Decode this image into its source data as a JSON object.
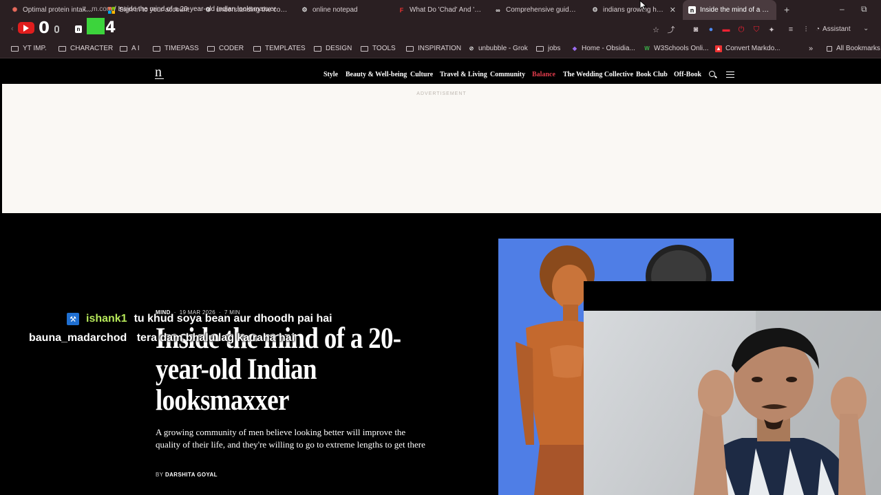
{
  "browser": {
    "tabs": [
      {
        "label": "Optimal protein intake pe",
        "icon": "sparkle-tab-icon",
        "active": false
      },
      {
        "label": "Sign in to your account",
        "icon": "microsoft-tab-icon",
        "active": false
      },
      {
        "label": "understanding the conce",
        "icon": "openai-tab-icon",
        "active": false
      },
      {
        "label": "online notepad",
        "icon": "openai-tab-icon",
        "active": false
      },
      {
        "label": "What Do 'Chad' And 'Chu",
        "icon": "f-tab-icon",
        "active": false
      },
      {
        "label": "Comprehensive guide to c",
        "icon": "infinity-tab-icon",
        "active": false
      },
      {
        "label": "indians growing hype",
        "icon": "openai-tab-icon",
        "active": false
      },
      {
        "label": "Inside the mind of a 20-ye",
        "icon": "n-tab-icon",
        "active": true
      }
    ],
    "address": {
      "domain": "t...m.com",
      "path": "/ Inside the mind of a 20-year-old Indian looksmaxxer"
    },
    "assistant_label": "Assistant",
    "bookmarks": [
      {
        "label": "YT IMP.",
        "type": "folder"
      },
      {
        "label": "CHARACTER",
        "type": "folder"
      },
      {
        "label": "A I",
        "type": "folder"
      },
      {
        "label": "TIMEPASS",
        "type": "folder"
      },
      {
        "label": "CODER",
        "type": "folder"
      },
      {
        "label": "TEMPLATES",
        "type": "folder"
      },
      {
        "label": "DESIGN",
        "type": "folder"
      },
      {
        "label": "TOOLS",
        "type": "folder"
      },
      {
        "label": "INSPIRATION",
        "type": "folder"
      },
      {
        "label": "unbubble - Grok",
        "type": "link"
      },
      {
        "label": "jobs",
        "type": "folder"
      },
      {
        "label": "Home - Obsidia...",
        "type": "link"
      },
      {
        "label": "W3Schools Onli...",
        "type": "link"
      },
      {
        "label": "Convert Markdo...",
        "type": "link"
      }
    ],
    "all_bookmarks_label": "All Bookmarks"
  },
  "stream_overlay": {
    "counter_left": "0",
    "counter_right": "4"
  },
  "site": {
    "logo": "n",
    "nav": [
      {
        "label": "Style",
        "highlight": false
      },
      {
        "label": "Beauty & Well-being",
        "highlight": false
      },
      {
        "label": "Culture",
        "highlight": false
      },
      {
        "label": "Travel & Living",
        "highlight": false
      },
      {
        "label": "Community",
        "highlight": false
      },
      {
        "label": "Balance",
        "highlight": true
      },
      {
        "label": "The Wedding Collective",
        "highlight": false
      },
      {
        "label": "Book Club",
        "highlight": false
      },
      {
        "label": "Off-Book",
        "highlight": false
      }
    ],
    "nav_highlight_color": "#e03b4b",
    "ad_label": "ADVERTISEMENT"
  },
  "article": {
    "category": "MIND",
    "date": "19 MAR 2026",
    "read_time": "7 MIN",
    "title": "Inside the mind of a 20-year-old Indian looksmaxxer",
    "subtitle": "A growing community of men believe looking better will improve the quality of their life, and they're willing to go to extreme lengths to get there",
    "byline_prefix": "BY",
    "author": "DARSHITA GOYAL"
  },
  "chat": [
    {
      "user": "ishank1",
      "message": "tu khud soya bean aur dhoodh pai hai",
      "user_color": "#b6e85a"
    },
    {
      "user": "bauna_madarchod",
      "message": "tera dam bhalu lag ka raha hai",
      "user_color": "#ffffff"
    }
  ]
}
